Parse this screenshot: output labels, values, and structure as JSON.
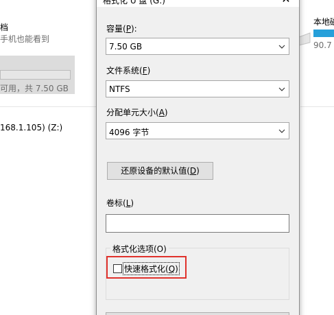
{
  "background": {
    "left_title": "档",
    "left_subtitle": "手机也能看到",
    "left_free": "可用，共 7.50 GB",
    "network_drive": "168.1.105) (Z:)",
    "right_drive_name": "本地磁",
    "right_drive_size": "90.7"
  },
  "dialog": {
    "title": "格式化 U 盘 (G:)",
    "close_glyph": "✕",
    "capacity": {
      "label": "容量(",
      "key": "P",
      "tail": "):",
      "value": "7.50 GB"
    },
    "filesystem": {
      "label": "文件系统(",
      "key": "F",
      "tail": ")",
      "value": "NTFS"
    },
    "allocation": {
      "label": "分配单元大小(",
      "key": "A",
      "tail": ")",
      "value": "4096 字节"
    },
    "restore": {
      "label": "还原设备的默认值(",
      "key": "D",
      "tail": ")"
    },
    "volume": {
      "label": "卷标(",
      "key": "L",
      "tail": ")",
      "value": ""
    },
    "options": {
      "legend": "格式化选项(O)",
      "quick": {
        "label": "快速格式化(",
        "key": "Q",
        "tail": ")",
        "checked": false
      }
    }
  },
  "colors": {
    "highlight": "#e0312b",
    "accent_bar": "#26a0da"
  },
  "icons": {
    "chevron": "chevron-down-icon",
    "close": "close-icon",
    "drive": "drive-icon"
  }
}
